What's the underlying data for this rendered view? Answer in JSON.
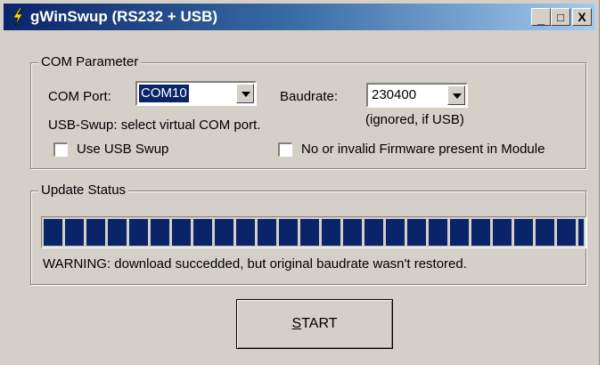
{
  "window": {
    "title": "gWinSwup (RS232 + USB)",
    "controls": {
      "minimize": "_",
      "maximize": "□",
      "close": "X"
    }
  },
  "com_parameter": {
    "legend": "COM Parameter",
    "com_port_label": "COM Port:",
    "com_port_value": "COM10",
    "baudrate_label": "Baudrate:",
    "baudrate_value": "230400",
    "usb_hint": "USB-Swup: select virtual COM port.",
    "baud_hint": "(ignored, if USB)",
    "use_usb_label": "Use USB Swup",
    "use_usb_checked": false,
    "no_firmware_label": "No or invalid Firmware present in Module",
    "no_firmware_checked": false
  },
  "update_status": {
    "legend": "Update Status",
    "progress": 1.0,
    "message": "WARNING: download succedded, but original baudrate wasn't restored."
  },
  "start_button": {
    "mnemonic": "S",
    "rest": "TART"
  },
  "colors": {
    "title_start": "#0a246a",
    "title_end": "#a6caf0",
    "progress": "#0a246a",
    "face": "#d4d0c8"
  }
}
